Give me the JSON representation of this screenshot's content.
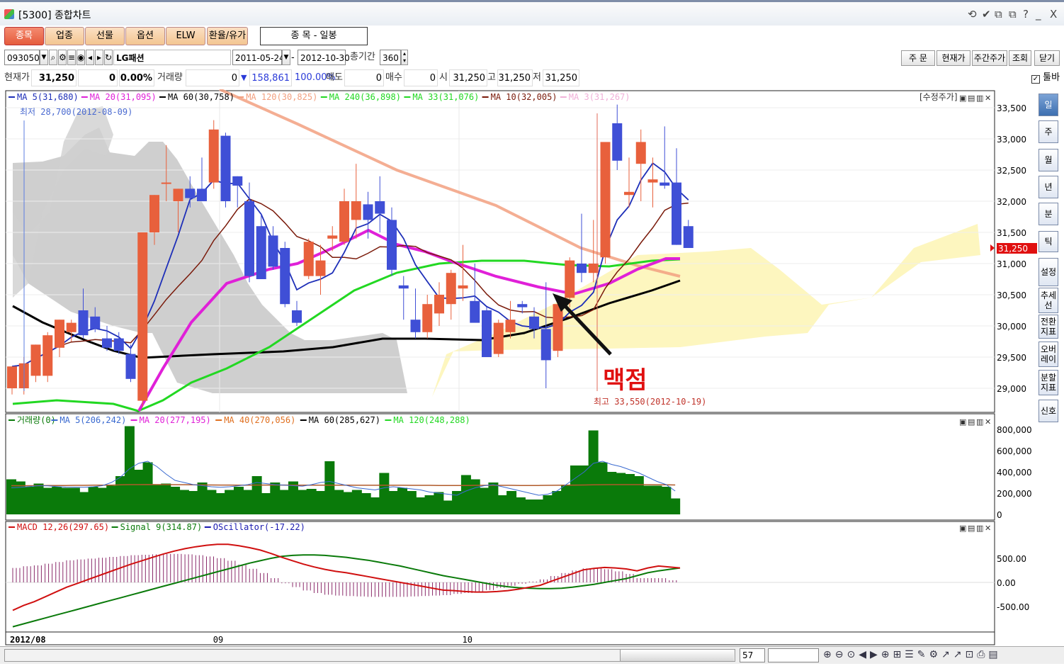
{
  "window": {
    "title": "[5300] 종합차트",
    "controls": [
      "⟲",
      "✔",
      "⧉",
      "⧉",
      "?",
      "_",
      "X"
    ]
  },
  "tabs": [
    "종목",
    "업종",
    "선물",
    "옵션",
    "ELW",
    "환율/유가"
  ],
  "period_label": "종      목 - 일봉",
  "toolbar": {
    "code": "093050",
    "stock_name": "LG패션",
    "start_date": "2011-05-24",
    "end_date": "2012-10-30",
    "count_label": "총기간",
    "count_value": "360",
    "buttons": [
      "주  문",
      "현재가",
      "주간주가",
      "조회",
      "닫기"
    ],
    "toolbar_checkbox": "툴바"
  },
  "quote": {
    "price_label": "현재가",
    "price": "31,250",
    "change": "0",
    "change_pct": "0.00%",
    "volume_label": "거래량",
    "volume": "0",
    "trade_amount": "158,861",
    "strength": "100.00%",
    "sell_label": "매도",
    "sell": "0",
    "buy_label": "매수",
    "buy": "0",
    "open_label": "시",
    "open": "31,250",
    "high_label": "고",
    "high": "31,250",
    "low_label": "저",
    "low": "31,250"
  },
  "sidebar": [
    "일",
    "주",
    "월",
    "년",
    "분",
    "틱",
    "설정",
    "추세선",
    "전환지표",
    "오버레이",
    "분할지표",
    "신호"
  ],
  "annotation": {
    "text": "맥점"
  },
  "bottom": {
    "zoom_value": "57"
  },
  "colors": {
    "up": "#e8603c",
    "down": "#3f4fd6",
    "volume": "#0a7a0a",
    "cloud": "#fdf6bf",
    "cloud_neg": "#cfcfcf",
    "ma5": "#1e2fb8",
    "ma20": "#e020d8",
    "ma60": "#000000",
    "ma120": "#f2a080",
    "ma240": "#22d822",
    "ma10": "#7a1a0a",
    "macd": "#d01010",
    "signal": "#0a7a0a",
    "osc": "#8a2a6a",
    "current": "#e01010"
  },
  "chart_data": {
    "type": "candlestick",
    "price_panel": {
      "legend": [
        {
          "name": "MA 5(31,680)",
          "color": "#1e2fb8"
        },
        {
          "name": "MA 20(31,095)",
          "color": "#e020d8"
        },
        {
          "name": "MA 60(30,758)",
          "color": "#000000"
        },
        {
          "name": "MA 120(30,825)",
          "color": "#f2a080"
        },
        {
          "name": "MA 240(36,898)",
          "color": "#22d822"
        },
        {
          "name": "MA 33(31,076)",
          "color": "#22d822"
        },
        {
          "name": "MA 10(32,005)",
          "color": "#7a1a0a"
        },
        {
          "name": "MA 3(31,267)",
          "color": "#f0b0d8"
        }
      ],
      "adjusted_label": "[수정주가]",
      "low_note": "최저 28,700(2012-08-09)",
      "high_note": "최고 33,550(2012-10-19)",
      "current_price_tag": "31,250",
      "yticks": [
        "33,500",
        "33,000",
        "32,500",
        "32,000",
        "31,500",
        "31,000",
        "30,500",
        "30,000",
        "29,500",
        "29,000"
      ],
      "ylim": [
        28600,
        33750
      ],
      "candles": [
        {
          "o": 29000,
          "h": 29300,
          "l": 28900,
          "c": 29350
        },
        {
          "o": 29000,
          "h": 29500,
          "l": 28900,
          "c": 29400
        },
        {
          "o": 29200,
          "h": 29700,
          "l": 29100,
          "c": 29700
        },
        {
          "o": 29200,
          "h": 29900,
          "l": 29100,
          "c": 29850
        },
        {
          "o": 29650,
          "h": 30100,
          "l": 29500,
          "c": 30100
        },
        {
          "o": 29900,
          "h": 30100,
          "l": 29750,
          "c": 30050
        },
        {
          "o": 30250,
          "h": 30600,
          "l": 29800,
          "c": 29850
        },
        {
          "o": 30150,
          "h": 30300,
          "l": 29900,
          "c": 29950
        },
        {
          "o": 29800,
          "h": 30000,
          "l": 29600,
          "c": 29650
        },
        {
          "o": 29800,
          "h": 29900,
          "l": 29550,
          "c": 29600
        },
        {
          "o": 29550,
          "h": 29700,
          "l": 29100,
          "c": 29150
        },
        {
          "o": 28800,
          "h": 31500,
          "l": 28700,
          "c": 31500
        },
        {
          "o": 31500,
          "h": 32100,
          "l": 31300,
          "c": 32100
        },
        {
          "o": 32300,
          "h": 32900,
          "l": 32000,
          "c": 32300
        },
        {
          "o": 32000,
          "h": 32200,
          "l": 31500,
          "c": 32200
        },
        {
          "o": 32200,
          "h": 32400,
          "l": 31900,
          "c": 32050
        },
        {
          "o": 32200,
          "h": 32700,
          "l": 32000,
          "c": 32000
        },
        {
          "o": 32300,
          "h": 33300,
          "l": 32200,
          "c": 33150
        },
        {
          "o": 33050,
          "h": 33100,
          "l": 31900,
          "c": 32000
        },
        {
          "o": 32400,
          "h": 32400,
          "l": 31900,
          "c": 32250
        },
        {
          "o": 32000,
          "h": 32300,
          "l": 30700,
          "c": 30800
        },
        {
          "o": 31600,
          "h": 31800,
          "l": 31000,
          "c": 30750
        },
        {
          "o": 31450,
          "h": 31600,
          "l": 30900,
          "c": 30950
        },
        {
          "o": 31250,
          "h": 31350,
          "l": 30300,
          "c": 30350
        },
        {
          "o": 30250,
          "h": 30400,
          "l": 30000,
          "c": 30050
        },
        {
          "o": 30800,
          "h": 31400,
          "l": 30750,
          "c": 31350
        },
        {
          "o": 30800,
          "h": 31300,
          "l": 30500,
          "c": 31050
        },
        {
          "o": 31400,
          "h": 31600,
          "l": 31200,
          "c": 31450
        },
        {
          "o": 31350,
          "h": 32200,
          "l": 31300,
          "c": 32000
        },
        {
          "o": 31700,
          "h": 32600,
          "l": 31400,
          "c": 32000
        },
        {
          "o": 31950,
          "h": 32150,
          "l": 31400,
          "c": 31700
        },
        {
          "o": 32000,
          "h": 32400,
          "l": 31500,
          "c": 31800
        },
        {
          "o": 31700,
          "h": 31900,
          "l": 30800,
          "c": 30900
        },
        {
          "o": 30650,
          "h": 30800,
          "l": 30100,
          "c": 30600
        },
        {
          "o": 30100,
          "h": 30600,
          "l": 29800,
          "c": 29900
        },
        {
          "o": 29900,
          "h": 30500,
          "l": 29800,
          "c": 30350
        },
        {
          "o": 30200,
          "h": 30700,
          "l": 30000,
          "c": 30500
        },
        {
          "o": 30350,
          "h": 30900,
          "l": 30100,
          "c": 30850
        },
        {
          "o": 30600,
          "h": 31300,
          "l": 30400,
          "c": 30650
        },
        {
          "o": 30400,
          "h": 31000,
          "l": 30100,
          "c": 30050
        },
        {
          "o": 30250,
          "h": 30300,
          "l": 29500,
          "c": 29500
        },
        {
          "o": 29550,
          "h": 30100,
          "l": 29500,
          "c": 30050
        },
        {
          "o": 29900,
          "h": 30400,
          "l": 29800,
          "c": 30100
        },
        {
          "o": 30350,
          "h": 30400,
          "l": 30200,
          "c": 30300
        },
        {
          "o": 30150,
          "h": 30300,
          "l": 29800,
          "c": 29950
        },
        {
          "o": 29950,
          "h": 30700,
          "l": 29000,
          "c": 29450
        },
        {
          "o": 29600,
          "h": 30400,
          "l": 29500,
          "c": 30350
        },
        {
          "o": 30450,
          "h": 31100,
          "l": 30300,
          "c": 31050
        },
        {
          "o": 31000,
          "h": 31800,
          "l": 30700,
          "c": 30850
        },
        {
          "o": 30850,
          "h": 31700,
          "l": 30700,
          "c": 31000
        },
        {
          "o": 31100,
          "h": 32900,
          "l": 31000,
          "c": 32950
        },
        {
          "o": 33250,
          "h": 33550,
          "l": 32500,
          "c": 32650
        },
        {
          "o": 32100,
          "h": 32700,
          "l": 31900,
          "c": 32150
        },
        {
          "o": 32600,
          "h": 33150,
          "l": 32000,
          "c": 32950
        },
        {
          "o": 32300,
          "h": 32700,
          "l": 31900,
          "c": 32350
        },
        {
          "o": 32300,
          "h": 33200,
          "l": 32200,
          "c": 32250
        },
        {
          "o": 32300,
          "h": 32850,
          "l": 31300,
          "c": 31300
        },
        {
          "o": 31600,
          "h": 31700,
          "l": 31250,
          "c": 31250
        }
      ]
    },
    "volume_panel": {
      "legend": [
        {
          "name": "거래량(0)",
          "color": "#0a7a0a"
        },
        {
          "name": "MA 5(206,242)",
          "color": "#3a6ad0"
        },
        {
          "name": "MA 20(277,195)",
          "color": "#e020d8"
        },
        {
          "name": "MA 40(270,056)",
          "color": "#e07020"
        },
        {
          "name": "MA 60(285,627)",
          "color": "#000000"
        },
        {
          "name": "MA 120(248,288)",
          "color": "#22d822"
        }
      ],
      "yticks": [
        "800,000",
        "600,000",
        "400,000",
        "200,000",
        "0"
      ],
      "ylim": [
        0,
        800000
      ],
      "values": [
        330000,
        310000,
        260000,
        290000,
        250000,
        260000,
        250000,
        250000,
        210000,
        260000,
        250000,
        270000,
        360000,
        830000,
        420000,
        490000,
        280000,
        290000,
        260000,
        230000,
        220000,
        300000,
        230000,
        200000,
        230000,
        260000,
        230000,
        360000,
        200000,
        300000,
        230000,
        310000,
        230000,
        240000,
        220000,
        500000,
        230000,
        210000,
        230000,
        200000,
        160000,
        390000,
        220000,
        250000,
        220000,
        160000,
        180000,
        210000,
        130000,
        220000,
        370000,
        330000,
        250000,
        300000,
        180000,
        220000,
        160000,
        140000,
        140000,
        180000,
        220000,
        270000,
        460000,
        460000,
        790000,
        490000,
        400000,
        390000,
        380000,
        360000,
        270000,
        270000,
        260000,
        150000
      ],
      "ma5": [
        250000,
        255000,
        262000,
        270000,
        268000,
        262000,
        257000,
        256000,
        255000,
        260000,
        270000,
        300000,
        350000,
        430000,
        480000,
        500000,
        450000,
        380000,
        320000,
        300000,
        280000,
        270000,
        260000,
        255000,
        260000,
        270000,
        280000,
        300000,
        290000,
        280000,
        275000,
        270000,
        265000,
        280000,
        300000,
        310000,
        290000,
        270000,
        250000,
        240000,
        230000,
        250000,
        260000,
        250000,
        240000,
        230000,
        210000,
        200000,
        190000,
        180000,
        220000,
        250000,
        270000,
        280000,
        260000,
        240000,
        220000,
        200000,
        180000,
        190000,
        220000,
        280000,
        340000,
        400000,
        480000,
        500000,
        470000,
        450000,
        420000,
        390000,
        350000,
        310000,
        280000,
        220000
      ],
      "ma20": [
        270000,
        270000,
        270000,
        270000,
        272000,
        272000,
        272000,
        273000,
        273000,
        275000,
        275000,
        275000,
        278000,
        280000,
        280000,
        281000,
        280000,
        280000,
        279000,
        279000,
        278000,
        277000,
        277000,
        276000,
        276000,
        275000,
        275000,
        276000,
        276000,
        276000,
        276000,
        275000,
        275000,
        275000,
        275000,
        275000,
        275000,
        275000,
        274000,
        274000,
        274000,
        274000,
        274000,
        274000,
        273000,
        273000,
        273000,
        272000,
        272000,
        272000,
        272000,
        273000,
        273000,
        273000,
        273000,
        273000,
        272000,
        272000,
        272000,
        273000,
        274000,
        275000,
        276000,
        277000,
        278000,
        279000,
        280000,
        280000,
        280000,
        280000,
        279000,
        278000,
        278000,
        277000
      ]
    },
    "macd_panel": {
      "legend": [
        {
          "name": "MACD 12,26(297.65)",
          "color": "#d01010"
        },
        {
          "name": "Signal 9(314.87)",
          "color": "#0a7a0a"
        },
        {
          "name": "OScillator(-17.22)",
          "color": "#1a1ab0"
        }
      ],
      "yticks": [
        "500.00",
        "0.00",
        "-500.00"
      ],
      "ylim": [
        -1000,
        1000
      ],
      "macd": [
        -580,
        -480,
        -400,
        -300,
        -200,
        -100,
        -20,
        60,
        140,
        220,
        300,
        380,
        450,
        520,
        590,
        650,
        700,
        740,
        770,
        790,
        790,
        760,
        720,
        670,
        600,
        520,
        450,
        380,
        320,
        270,
        230,
        200,
        160,
        120,
        80,
        40,
        0,
        -40,
        -80,
        -120,
        -160,
        -170,
        -190,
        -200,
        -200,
        -190,
        -170,
        -140,
        -100,
        -60,
        20,
        100,
        180,
        260,
        290,
        310,
        300,
        280,
        240,
        300,
        340,
        320,
        300
      ],
      "signal": [
        -920,
        -860,
        -800,
        -740,
        -680,
        -620,
        -560,
        -500,
        -440,
        -380,
        -320,
        -260,
        -200,
        -140,
        -80,
        -20,
        40,
        100,
        160,
        220,
        280,
        340,
        400,
        450,
        500,
        540,
        560,
        570,
        570,
        560,
        540,
        520,
        490,
        460,
        420,
        380,
        340,
        290,
        240,
        190,
        140,
        100,
        60,
        20,
        -20,
        -60,
        -90,
        -110,
        -120,
        -130,
        -130,
        -120,
        -100,
        -70,
        -40,
        0,
        40,
        80,
        140,
        200,
        240,
        270,
        300
      ],
      "xlabels": [
        {
          "text": "2012/08",
          "index": 0
        },
        {
          "text": "09",
          "index": 17
        },
        {
          "text": "10",
          "index": 38
        }
      ]
    }
  }
}
